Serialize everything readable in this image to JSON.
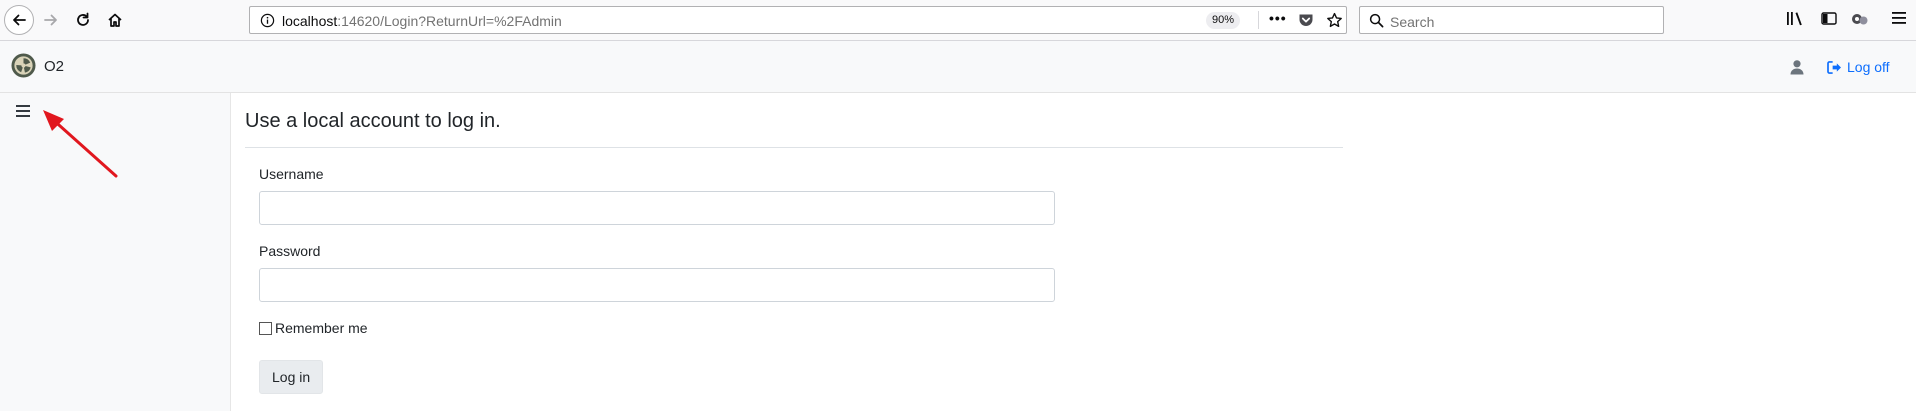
{
  "browser": {
    "url_host": "localhost",
    "url_rest": ":14620/Login?ReturnUrl=%2FAdmin",
    "zoom": "90%",
    "search_placeholder": "Search"
  },
  "site": {
    "brand": "O2",
    "logoff_label": "Log off"
  },
  "login": {
    "heading": "Use a local account to log in.",
    "username_label": "Username",
    "username_value": "",
    "password_label": "Password",
    "password_value": "",
    "remember_label": "Remember me",
    "submit_label": "Log in"
  },
  "colors": {
    "link": "#0d6efd",
    "annotation_arrow": "#e1171e"
  },
  "icons": [
    "back-icon",
    "forward-icon",
    "reload-icon",
    "home-icon",
    "info-icon",
    "more-actions-icon",
    "pocket-icon",
    "bookmark-star-icon",
    "search-icon",
    "library-icon",
    "sidebar-toggle-icon",
    "extension-icon",
    "app-menu-icon",
    "brand-logo",
    "user-icon",
    "logoff-icon",
    "hamburger-menu-icon",
    "annotation-arrow"
  ]
}
